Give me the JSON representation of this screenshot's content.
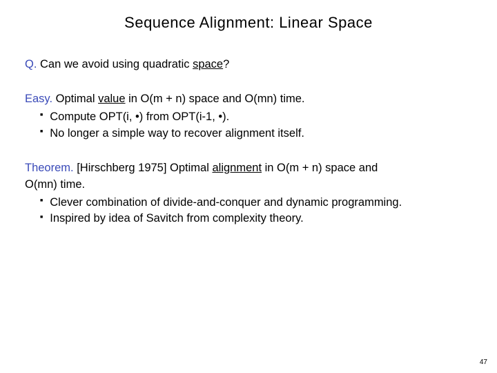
{
  "title": "Sequence Alignment:  Linear Space",
  "question": {
    "label": "Q.",
    "prefix": "Can we avoid using quadratic ",
    "space_word": "space",
    "suffix": "?"
  },
  "easy": {
    "label": "Easy.",
    "line_prefix": "Optimal ",
    "value_word": "value",
    "line_suffix": " in O(m + n) space and O(mn) time.",
    "bullets": [
      "Compute OPT(i, •) from OPT(i-1, •).",
      "No longer a simple way to recover alignment itself."
    ]
  },
  "theorem": {
    "label": "Theorem.",
    "cite": "[Hirschberg 1975]",
    "mid_prefix": " Optimal ",
    "alignment_word": "alignment",
    "mid_suffix": " in O(m + n) space and",
    "line2": "O(mn) time.",
    "bullets": [
      "Clever combination of divide-and-conquer and dynamic programming.",
      "Inspired by idea of Savitch from complexity theory."
    ]
  },
  "page_number": "47"
}
